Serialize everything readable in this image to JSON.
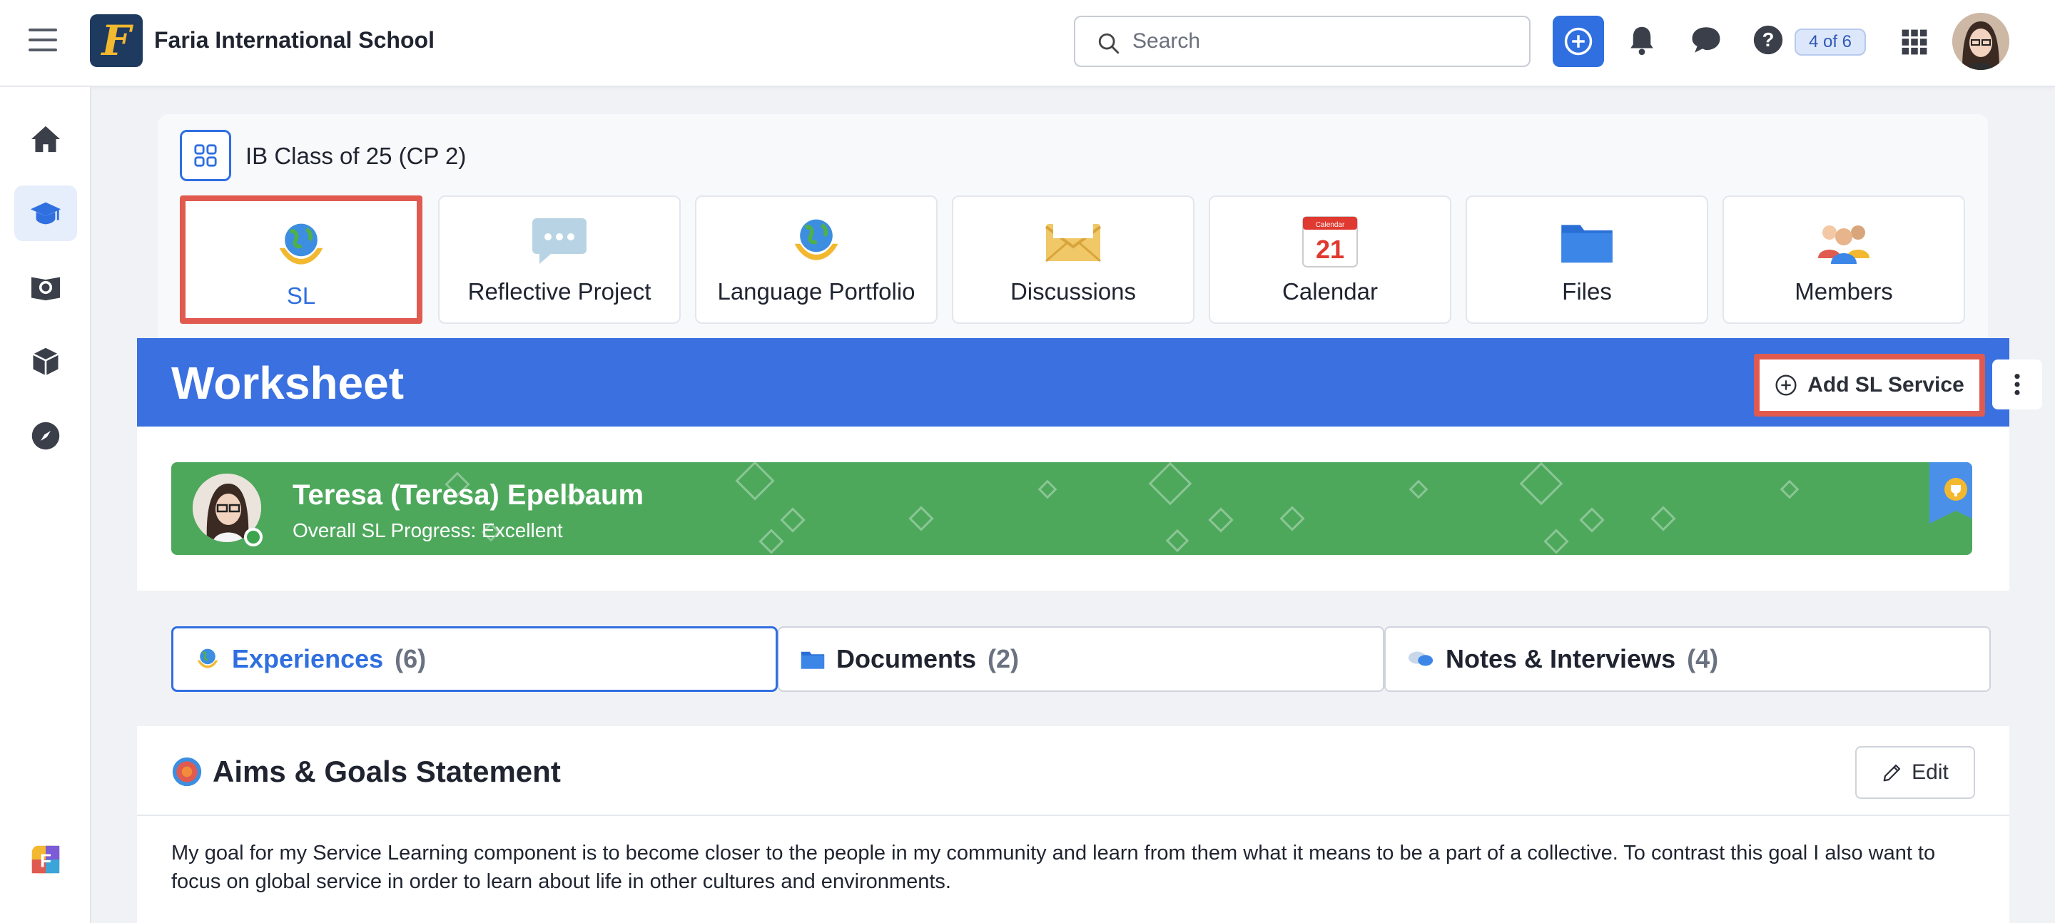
{
  "header": {
    "logo_letter": "F",
    "school_name": "Faria International School",
    "search_placeholder": "Search",
    "page_counter": "4 of 6"
  },
  "rail": {
    "items": [
      "home-icon",
      "graduation-cap-icon",
      "globe-book-icon",
      "cube-icon",
      "compass-icon"
    ],
    "active": "graduation-cap-icon"
  },
  "class": {
    "title": "IB Class of 25 (CP 2)",
    "tiles": [
      {
        "label": "SL",
        "icon": "globe-hands-icon",
        "selected": true
      },
      {
        "label": "Reflective Project",
        "icon": "speech-bubble-icon"
      },
      {
        "label": "Language Portfolio",
        "icon": "globe-hands-icon"
      },
      {
        "label": "Discussions",
        "icon": "envelope-icon"
      },
      {
        "label": "Calendar",
        "icon": "calendar-icon",
        "calendar_month": "Calendar",
        "calendar_day": "21"
      },
      {
        "label": "Files",
        "icon": "folder-icon"
      },
      {
        "label": "Members",
        "icon": "people-icon"
      }
    ]
  },
  "worksheet": {
    "title": "Worksheet",
    "add_button": "Add SL Service"
  },
  "student": {
    "name": "Teresa (Teresa) Epelbaum",
    "progress": "Overall SL Progress: Excellent"
  },
  "tabs": [
    {
      "label": "Experiences",
      "count": "(6)",
      "icon": "globe-hands-icon",
      "active": true
    },
    {
      "label": "Documents",
      "count": "(2)",
      "icon": "folder-icon"
    },
    {
      "label": "Notes & Interviews",
      "count": "(4)",
      "icon": "chat-bubbles-icon"
    }
  ],
  "aims": {
    "title": "Aims & Goals Statement",
    "edit_label": "Edit",
    "text": "My goal for my Service Learning component is to become closer to the people in my community and learn from them what it means to be a part of a collective. To contrast this goal I also want to focus on global service in order to learn about life in other cultures and environments."
  },
  "colors": {
    "primary": "#2f6fe0",
    "banner": "#3a70e0",
    "student_band": "#4ea85c",
    "highlight": "#e05a50"
  }
}
